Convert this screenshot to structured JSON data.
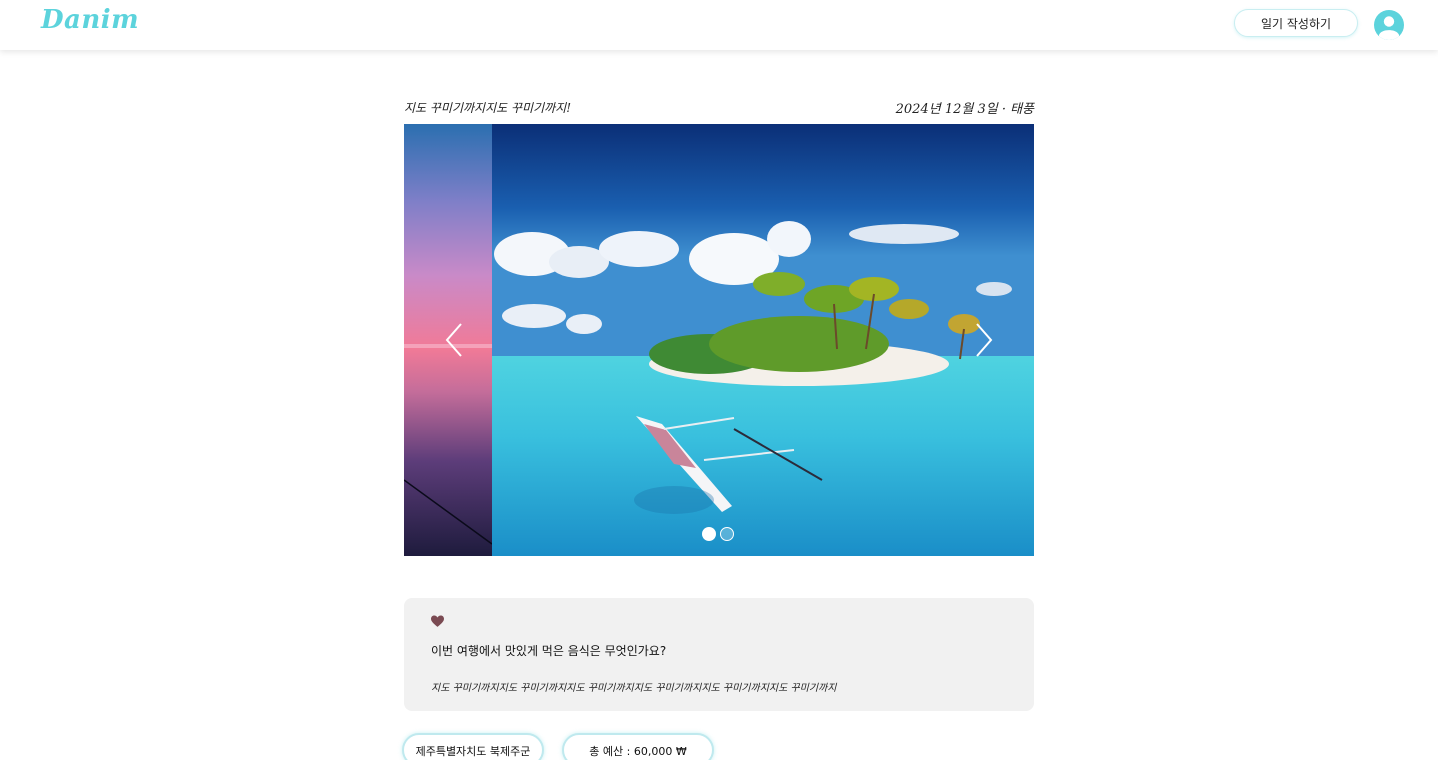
{
  "header": {
    "logo": "Danim",
    "write_button": "일기 작성하기",
    "avatar_icon": "user-avatar-icon",
    "accent_color": "#5cd3dc"
  },
  "post": {
    "title": "지도 꾸미기까지지도 꾸미기까지!",
    "date_weather": "2024년 12월 3일 · 태풍"
  },
  "carousel": {
    "prev_icon": "chevron-left-icon",
    "next_icon": "chevron-right-icon",
    "slide_count": 2,
    "active_slide": 1
  },
  "qa": {
    "heart_icon": "heart-icon",
    "heart_color": "#7a4a52",
    "question": "이번 여행에서 맛있게 먹은 음식은 무엇인가요?",
    "answer": "지도 꾸미기까지지도 꾸미기까지지도 꾸미기까지지도 꾸미기까지지도 꾸미기까지지도 꾸미기까지"
  },
  "tags": {
    "location": "제주특별자치도 북제주군",
    "budget": "총 예산 : 60,000 ₩"
  }
}
